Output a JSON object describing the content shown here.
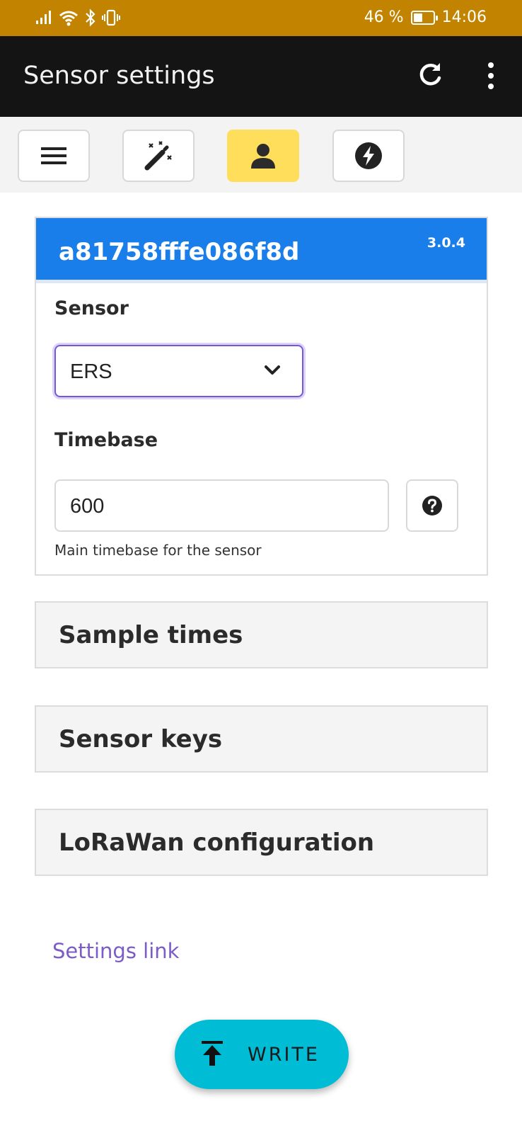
{
  "status_bar": {
    "battery": "46 %",
    "battery_level": 0.46,
    "time": "14:06",
    "icons": [
      "signal-icon",
      "wifi-icon",
      "bluetooth-icon",
      "vibrate-icon"
    ]
  },
  "app_bar": {
    "title": "Sensor settings",
    "icons": [
      "refresh-icon",
      "more-vert-icon"
    ]
  },
  "toolbar": {
    "buttons": [
      {
        "icon": "menu-icon",
        "active": false
      },
      {
        "icon": "magic-wand-icon",
        "active": false
      },
      {
        "icon": "user-icon",
        "active": true
      },
      {
        "icon": "bolt-icon",
        "active": false
      }
    ]
  },
  "device": {
    "id": "a81758fffe086f8d",
    "version": "3.0.4"
  },
  "form": {
    "sensor_label": "Sensor",
    "sensor_value": "ERS",
    "timebase_label": "Timebase",
    "timebase_value": "600",
    "timebase_help": "Main timebase for the sensor"
  },
  "sections": [
    {
      "title": "Sample times"
    },
    {
      "title": "Sensor keys"
    },
    {
      "title": "LoRaWan configuration"
    }
  ],
  "links": {
    "settings_link": "Settings link"
  },
  "actions": {
    "write_label": "WRITE"
  },
  "colors": {
    "status_bar": "#c28400",
    "app_bar": "#141414",
    "card_header": "#1a7eea",
    "active_tab": "#ffde5c",
    "fab": "#00bcd4",
    "link": "#7b5cc8",
    "select_focus": "#7458d8"
  }
}
